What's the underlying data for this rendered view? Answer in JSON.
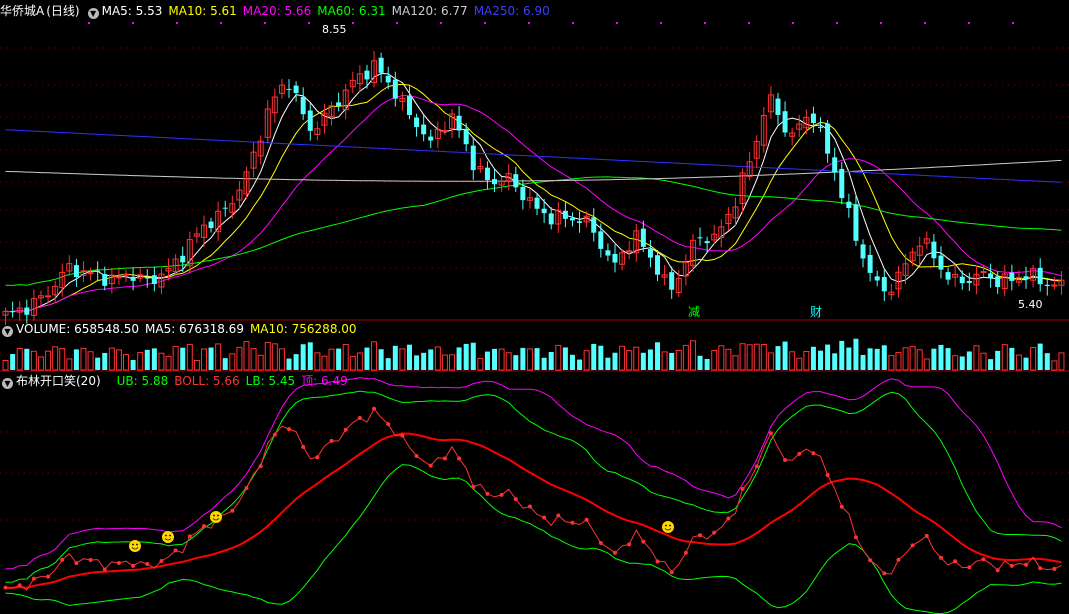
{
  "price_panel": {
    "stock_name": "华侨城A",
    "period": "(日线)",
    "ma": [
      {
        "label": "MA5: 5.53",
        "color": "#ffffff"
      },
      {
        "label": "MA10: 5.61",
        "color": "#ffff00"
      },
      {
        "label": "MA20: 5.66",
        "color": "#ff00ff"
      },
      {
        "label": "MA60: 6.31",
        "color": "#00ff00"
      },
      {
        "label": "MA120: 6.77",
        "color": "#cccccc"
      },
      {
        "label": "MA250: 6.90",
        "color": "#0000ff"
      }
    ],
    "high_label": "8.55",
    "low_label": "5.40",
    "markers": [
      "减",
      "财"
    ]
  },
  "volume_panel": {
    "title": "VOLUME: 658548.50",
    "ma5": "MA5: 676318.69",
    "ma10": "MA10: 756288.00"
  },
  "indicator_panel": {
    "title": "布林开口笑(20)",
    "ub": "UB: 5.88",
    "boll": "BOLL: 5.66",
    "lb": "LB: 5.45",
    "top": "顶: 6.49"
  },
  "colors": {
    "up": "#ff3232",
    "down": "#54ffff",
    "grid": "#800000",
    "ub": "#00ff00",
    "boll": "#ff0000",
    "lb": "#00ff00",
    "top": "#ff00ff",
    "smile": "#ffd700"
  },
  "chart_data": {
    "type": "candlestick",
    "price_range": [
      5.2,
      8.9
    ],
    "close_path": [
      5.0,
      5.05,
      5.1,
      5.2,
      5.3,
      5.5,
      5.65,
      5.55,
      5.55,
      5.5,
      5.45,
      5.55,
      5.5,
      5.45,
      5.5,
      5.6,
      5.75,
      5.95,
      6.15,
      6.25,
      6.35,
      6.55,
      6.8,
      7.2,
      7.65,
      7.95,
      8.1,
      7.75,
      7.45,
      7.55,
      7.75,
      7.9,
      8.1,
      8.2,
      8.3,
      8.1,
      7.9,
      7.65,
      7.5,
      7.25,
      7.5,
      7.6,
      7.35,
      7.0,
      6.8,
      6.75,
      6.85,
      6.65,
      6.55,
      6.35,
      6.3,
      6.3,
      6.25,
      6.3,
      6.1,
      5.85,
      5.65,
      5.9,
      6.05,
      5.8,
      5.6,
      5.3,
      5.55,
      5.9,
      6.05,
      6.0,
      6.2,
      6.5,
      6.9,
      7.3,
      7.9,
      7.65,
      7.35,
      7.5,
      7.7,
      7.35,
      6.95,
      6.55,
      6.05,
      5.7,
      5.4,
      5.3,
      5.5,
      5.75,
      6.0,
      5.85,
      5.6,
      5.45,
      5.45,
      5.5,
      5.55,
      5.45,
      5.45,
      5.5,
      5.55,
      5.45,
      5.4,
      5.4
    ]
  }
}
